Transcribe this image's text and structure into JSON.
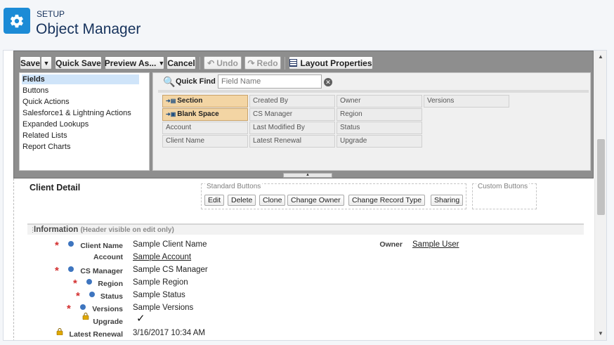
{
  "header": {
    "eyebrow": "SETUP",
    "title": "Object Manager",
    "icon": "gear-icon",
    "accent_color": "#1c8bd6"
  },
  "toolbar": {
    "save_label": "Save",
    "quick_save_label": "Quick Save",
    "preview_as_label": "Preview As...",
    "cancel_label": "Cancel",
    "undo_label": "Undo",
    "redo_label": "Redo",
    "layout_properties_label": "Layout Properties"
  },
  "palette": {
    "categories": [
      {
        "label": "Fields",
        "selected": true
      },
      {
        "label": "Buttons"
      },
      {
        "label": "Quick Actions"
      },
      {
        "label": "Salesforce1 & Lightning Actions"
      },
      {
        "label": "Expanded Lookups"
      },
      {
        "label": "Related Lists"
      },
      {
        "label": "Report Charts"
      }
    ],
    "quick_find_label": "Quick Find",
    "quick_find_placeholder": "Field Name",
    "fields": {
      "section": "Section",
      "blank_space": "Blank Space",
      "account": "Account",
      "client_name": "Client Name",
      "created_by": "Created By",
      "cs_manager": "CS Manager",
      "last_modified_by": "Last Modified By",
      "latest_renewal": "Latest Renewal",
      "owner": "Owner",
      "region": "Region",
      "status": "Status",
      "upgrade": "Upgrade",
      "versions": "Versions"
    }
  },
  "layout": {
    "section_title": "Client Detail",
    "standard_buttons_label": "Standard Buttons",
    "custom_buttons_label": "Custom Buttons",
    "standard_buttons": [
      "Edit",
      "Delete",
      "Clone",
      "Change Owner",
      "Change Record Type",
      "Sharing"
    ],
    "info_title": "Information",
    "info_hint": "(Header visible on edit only)",
    "rows": {
      "client_name": {
        "label": "Client Name",
        "value": "Sample Client Name"
      },
      "account": {
        "label": "Account",
        "value": "Sample Account"
      },
      "cs_manager": {
        "label": "CS Manager",
        "value": "Sample CS Manager"
      },
      "region": {
        "label": "Region",
        "value": "Sample Region"
      },
      "status": {
        "label": "Status",
        "value": "Sample Status"
      },
      "versions": {
        "label": "Versions",
        "value": "Sample Versions"
      },
      "upgrade": {
        "label": "Upgrade",
        "value": "✓"
      },
      "latest_renewal": {
        "label": "Latest Renewal",
        "value": "3/16/2017 10:34 AM"
      },
      "owner": {
        "label": "Owner",
        "value": "Sample User"
      }
    }
  }
}
